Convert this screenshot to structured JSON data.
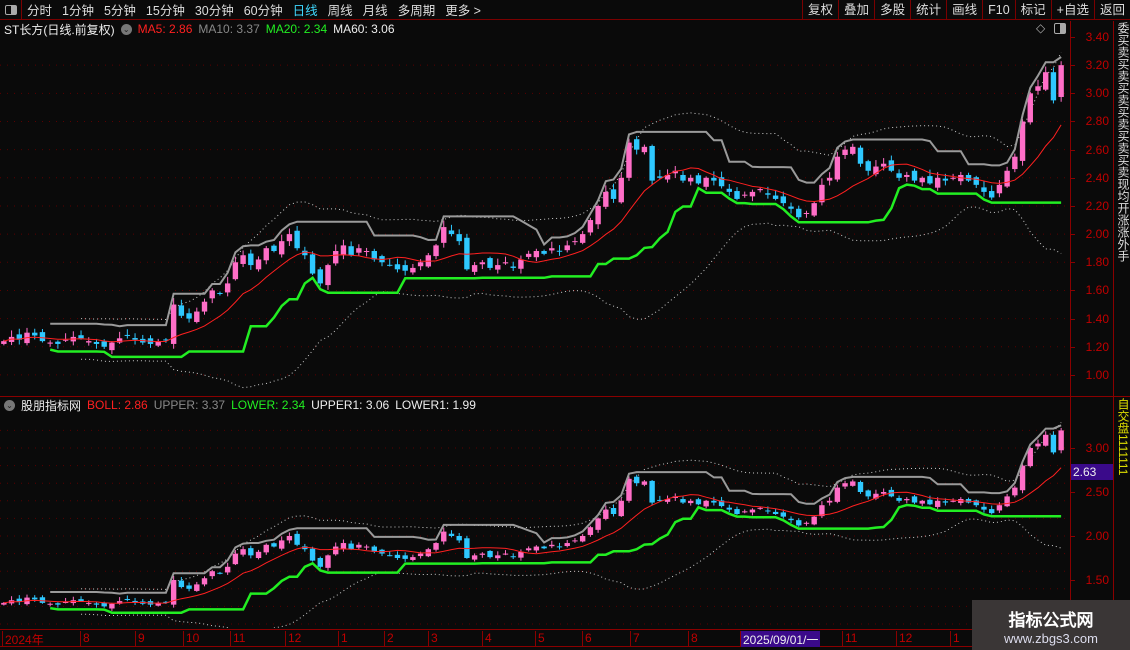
{
  "toolbar": {
    "periods": [
      "分时",
      "1分钟",
      "5分钟",
      "15分钟",
      "30分钟",
      "60分钟",
      "日线",
      "周线",
      "月线",
      "多周期",
      "更多 >"
    ],
    "active_period": "日线",
    "buttons": [
      "复权",
      "叠加",
      "多股",
      "统计",
      "画线",
      "F10",
      "标记",
      "+自选",
      "返回"
    ]
  },
  "main_info": {
    "title": "ST长方(日线.前复权)",
    "ma5": "MA5: 2.86",
    "ma10": "MA10: 3.37",
    "ma20": "MA20: 2.34",
    "ma60": "MA60: 3.06"
  },
  "indicator_info": {
    "title": "股朋指标网",
    "boll": "BOLL: 2.86",
    "upper": "UPPER: 3.37",
    "lower": "LOWER: 2.34",
    "upper1": "UPPER1: 3.06",
    "lower1": "LOWER1: 1.99"
  },
  "main_axis": [
    "3.40",
    "3.20",
    "3.00",
    "2.80",
    "2.60",
    "2.40",
    "2.20",
    "2.00",
    "1.80",
    "1.60",
    "1.40",
    "1.20",
    "1.00"
  ],
  "sub_axis": [
    "3.00",
    "2.50",
    "2.00",
    "1.50"
  ],
  "current_price": "2.63",
  "side_tab_top": "委买卖买卖买卖买卖买卖买卖现均开涨涨外手",
  "side_tab_bottom": "自交盘1111111",
  "date_axis": [
    "2024年",
    "8",
    "9",
    "10",
    "11",
    "12",
    "1",
    "2",
    "3",
    "4",
    "5",
    "6",
    "7",
    "8",
    "2025/09/01/一",
    "11",
    "12",
    "1"
  ],
  "watermark": {
    "title": "指标公式网",
    "url": "www.zbgs3.com"
  },
  "colors": {
    "up": "#ff6ec7",
    "down": "#2ec8ff",
    "ma": "#ff2020",
    "upper": "#9a9a9a",
    "lower": "#22ee22",
    "band": "#cccccc"
  },
  "chart_data": {
    "type": "candlestick",
    "ylim_main": [
      1.0,
      3.4
    ],
    "ylim_sub": [
      1.4,
      3.3
    ],
    "closes": [
      1.24,
      1.27,
      1.25,
      1.3,
      1.28,
      1.24,
      1.23,
      1.22,
      1.25,
      1.27,
      1.26,
      1.24,
      1.22,
      1.2,
      1.23,
      1.26,
      1.28,
      1.25,
      1.23,
      1.22,
      1.24,
      1.25,
      1.5,
      1.42,
      1.4,
      1.45,
      1.52,
      1.6,
      1.58,
      1.65,
      1.8,
      1.85,
      1.78,
      1.82,
      1.9,
      1.88,
      1.95,
      2.0,
      1.9,
      1.85,
      1.72,
      1.65,
      1.78,
      1.88,
      1.92,
      1.85,
      1.9,
      1.88,
      1.82,
      1.8,
      1.78,
      1.75,
      1.74,
      1.76,
      1.8,
      1.85,
      1.92,
      2.05,
      2.0,
      1.95,
      1.75,
      1.78,
      1.8,
      1.76,
      1.78,
      1.8,
      1.76,
      1.82,
      1.86,
      1.88,
      1.86,
      1.9,
      1.88,
      1.92,
      1.95,
      2.0,
      2.1,
      2.2,
      2.3,
      2.25,
      2.4,
      2.65,
      2.6,
      2.62,
      2.38,
      2.4,
      2.42,
      2.45,
      2.38,
      2.4,
      2.36,
      2.4,
      2.38,
      2.34,
      2.3,
      2.25,
      2.28,
      2.3,
      2.32,
      2.28,
      2.25,
      2.22,
      2.18,
      2.12,
      2.15,
      2.22,
      2.35,
      2.4,
      2.55,
      2.6,
      2.62,
      2.5,
      2.45,
      2.48,
      2.5,
      2.45,
      2.4,
      2.42,
      2.38,
      2.4,
      2.36,
      2.4,
      2.38,
      2.4,
      2.42,
      2.38,
      2.35,
      2.3,
      2.26,
      2.35,
      2.45,
      2.55,
      2.8,
      3.0,
      3.05,
      3.15,
      2.95,
      3.2
    ]
  }
}
